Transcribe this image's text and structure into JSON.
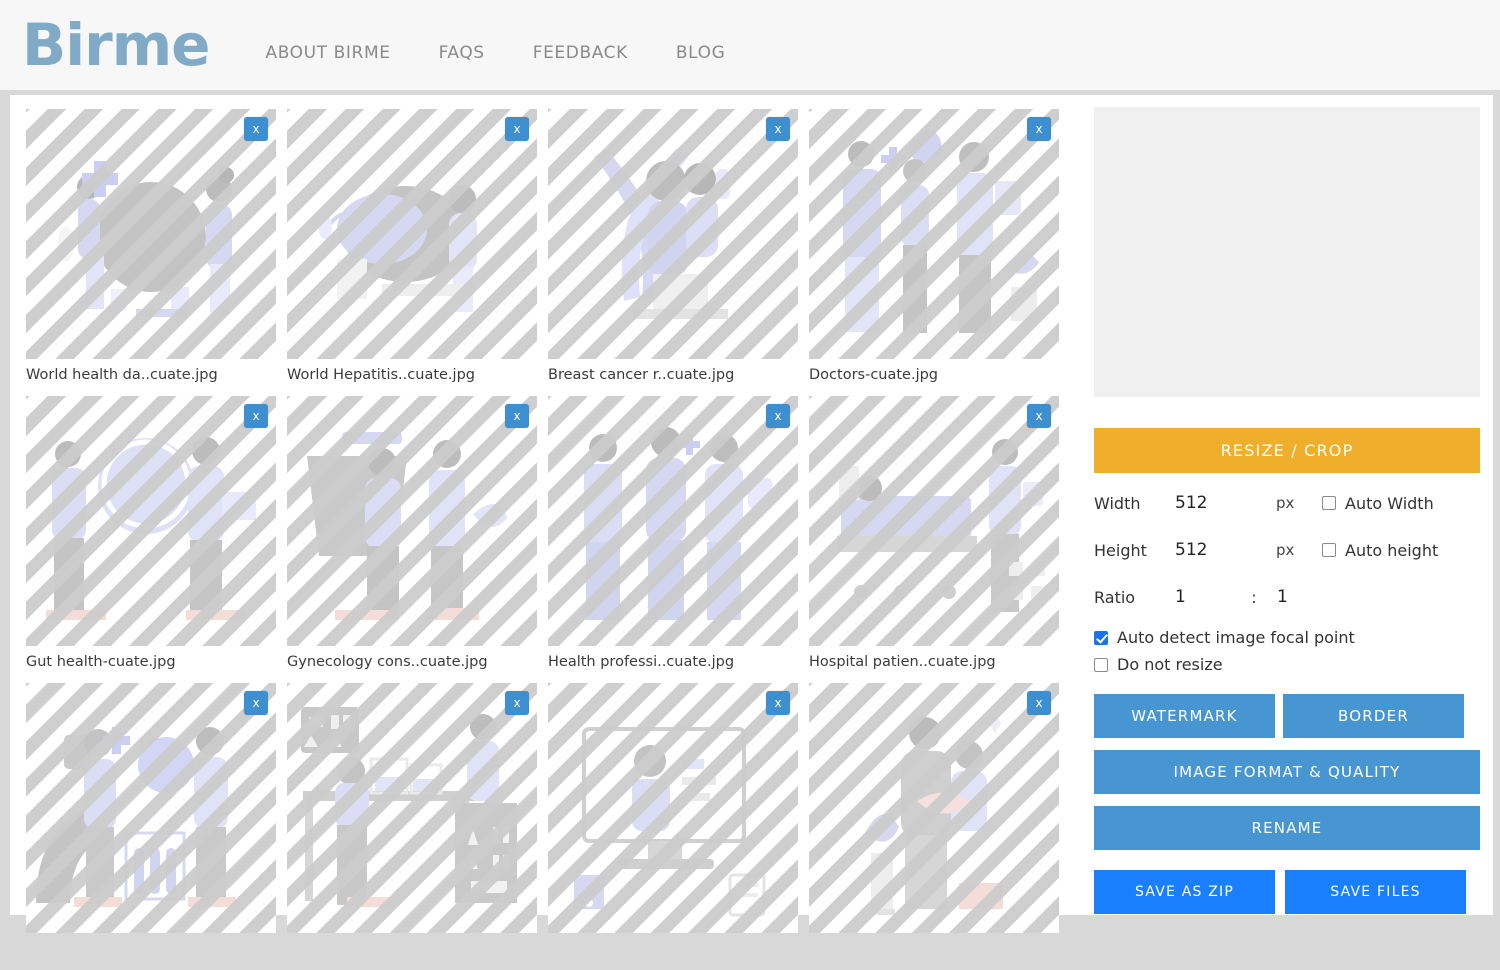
{
  "header": {
    "logo": "Birme",
    "nav": [
      {
        "label": "ABOUT BIRME"
      },
      {
        "label": "FAQS"
      },
      {
        "label": "FEEDBACK"
      },
      {
        "label": "BLOG"
      }
    ]
  },
  "thumbnails": [
    {
      "filename": "World health da..cuate.jpg",
      "close_label": "x"
    },
    {
      "filename": "World Hepatitis..cuate.jpg",
      "close_label": "x"
    },
    {
      "filename": "Breast cancer r..cuate.jpg",
      "close_label": "x"
    },
    {
      "filename": "Doctors-cuate.jpg",
      "close_label": "x"
    },
    {
      "filename": "Gut health-cuate.jpg",
      "close_label": "x"
    },
    {
      "filename": "Gynecology cons..cuate.jpg",
      "close_label": "x"
    },
    {
      "filename": "Health professi..cuate.jpg",
      "close_label": "x"
    },
    {
      "filename": "Hospital patien..cuate.jpg",
      "close_label": "x"
    },
    {
      "filename": "",
      "close_label": "x"
    },
    {
      "filename": "",
      "close_label": "x"
    },
    {
      "filename": "",
      "close_label": "x"
    },
    {
      "filename": "",
      "close_label": "x"
    }
  ],
  "settings": {
    "resize_crop_label": "RESIZE / CROP",
    "width": {
      "label": "Width",
      "value": "512",
      "unit": "px"
    },
    "height": {
      "label": "Height",
      "value": "512",
      "unit": "px"
    },
    "ratio": {
      "label": "Ratio",
      "value_left": "1",
      "separator": ":",
      "value_right": "1"
    },
    "auto_width": {
      "label": "Auto Width",
      "checked": false
    },
    "auto_height": {
      "label": "Auto height",
      "checked": false
    },
    "auto_focal": {
      "label": "Auto detect image focal point",
      "checked": true
    },
    "do_not_resize": {
      "label": "Do not resize",
      "checked": false
    },
    "watermark_label": "WATERMARK",
    "border_label": "BORDER",
    "image_format_label": "IMAGE FORMAT & QUALITY",
    "rename_label": "RENAME",
    "save_zip_label": "SAVE AS ZIP",
    "save_files_label": "SAVE FILES"
  },
  "colors": {
    "brand": "#81aac6",
    "accent_orange": "#efaf2b",
    "button_blue": "#4795d1",
    "save_blue": "#1a7ffc",
    "close_blue": "#3d8fcf"
  }
}
